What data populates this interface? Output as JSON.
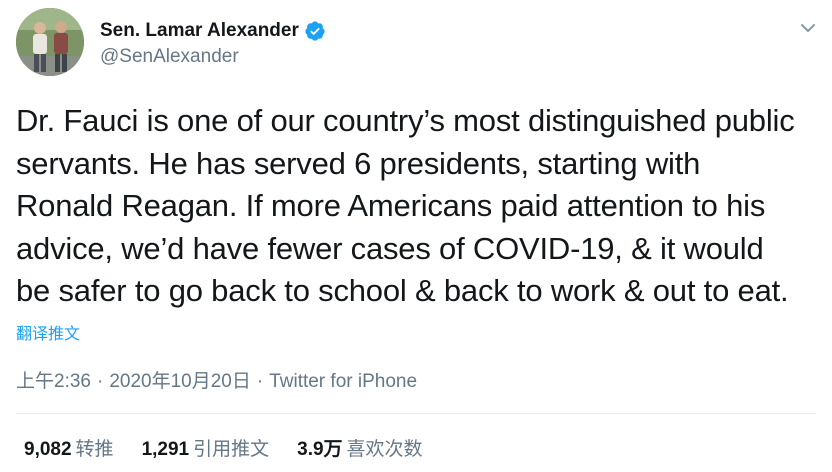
{
  "author": {
    "display_name": "Sen. Lamar Alexander",
    "handle": "@SenAlexander",
    "verified": true
  },
  "tweet": {
    "lines": [
      "Dr. Fauci is one of our country’s most distinguished public",
      "servants. He has served 6 presidents, starting with",
      "Ronald Reagan. If more Americans paid attention to his",
      "advice, we’d have fewer cases of COVID-19, & it would",
      "be safer to go back to school & back to work & out to eat."
    ],
    "translate_label": "翻译推文"
  },
  "meta": {
    "time": "上午2:36",
    "separator": "·",
    "date": "2020年10月20日",
    "source": "Twitter for iPhone"
  },
  "stats": {
    "retweets_count": "9,082",
    "retweets_label": "转推",
    "quotes_count": "1,291",
    "quotes_label": "引用推文",
    "likes_count": "3.9万",
    "likes_label": "喜欢次数"
  },
  "colors": {
    "accent": "#1da1f2",
    "secondary_text": "#657786",
    "primary_text": "#14171a"
  },
  "icons": {
    "verified": "verified-badge-icon",
    "more": "chevron-down-icon"
  }
}
